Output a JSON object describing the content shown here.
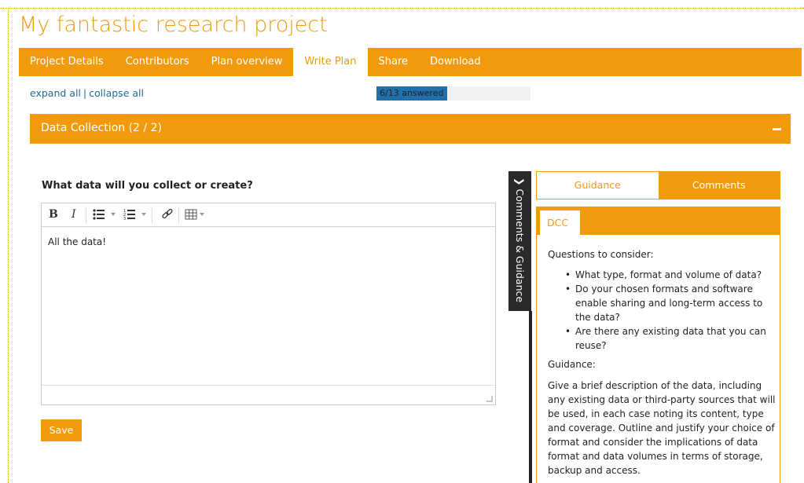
{
  "page": {
    "title": "My fantastic research project"
  },
  "nav": {
    "tabs": [
      {
        "label": "Project Details"
      },
      {
        "label": "Contributors"
      },
      {
        "label": "Plan overview"
      },
      {
        "label": "Write Plan",
        "active": true
      },
      {
        "label": "Share"
      },
      {
        "label": "Download"
      }
    ]
  },
  "controls": {
    "expand_all": "expand all",
    "separator": "|",
    "collapse_all": "collapse all"
  },
  "progress": {
    "label": "6/13 answered",
    "answered": 6,
    "total": 13
  },
  "section": {
    "title": "Data Collection (2 / 2)",
    "collapse_icon": "minus-icon"
  },
  "question": {
    "text": "What data will you collect or create?",
    "answer": "All the data!",
    "save_label": "Save"
  },
  "editor_toolbar": {
    "bold": "B",
    "italic": "I",
    "icons": [
      "bullet-list-icon",
      "numbered-list-icon",
      "link-icon",
      "table-icon"
    ]
  },
  "side_tab": {
    "label": "Comments & Guidance",
    "icon": "chevron-right-icon"
  },
  "panel": {
    "tabs": {
      "guidance": "Guidance",
      "comments": "Comments"
    },
    "source_tab": "DCC",
    "questions_heading": "Questions to consider:",
    "questions": [
      "What type, format and volume of data?",
      "Do your chosen formats and software enable sharing and long-term access to the data?",
      "Are there any existing data that you can reuse?"
    ],
    "guidance_heading": "Guidance:",
    "guidance_text": "Give a brief description of the data, including any existing data or third-party sources that will be used, in each case noting its content, type and coverage. Outline and justify your choice of format and consider the implications of data format and data volumes in terms of storage, backup and access."
  },
  "colors": {
    "accent": "#f19a0b",
    "link": "#1f6c8f",
    "progress": "#1f70ac",
    "dark_tab": "#2a2a2a"
  }
}
